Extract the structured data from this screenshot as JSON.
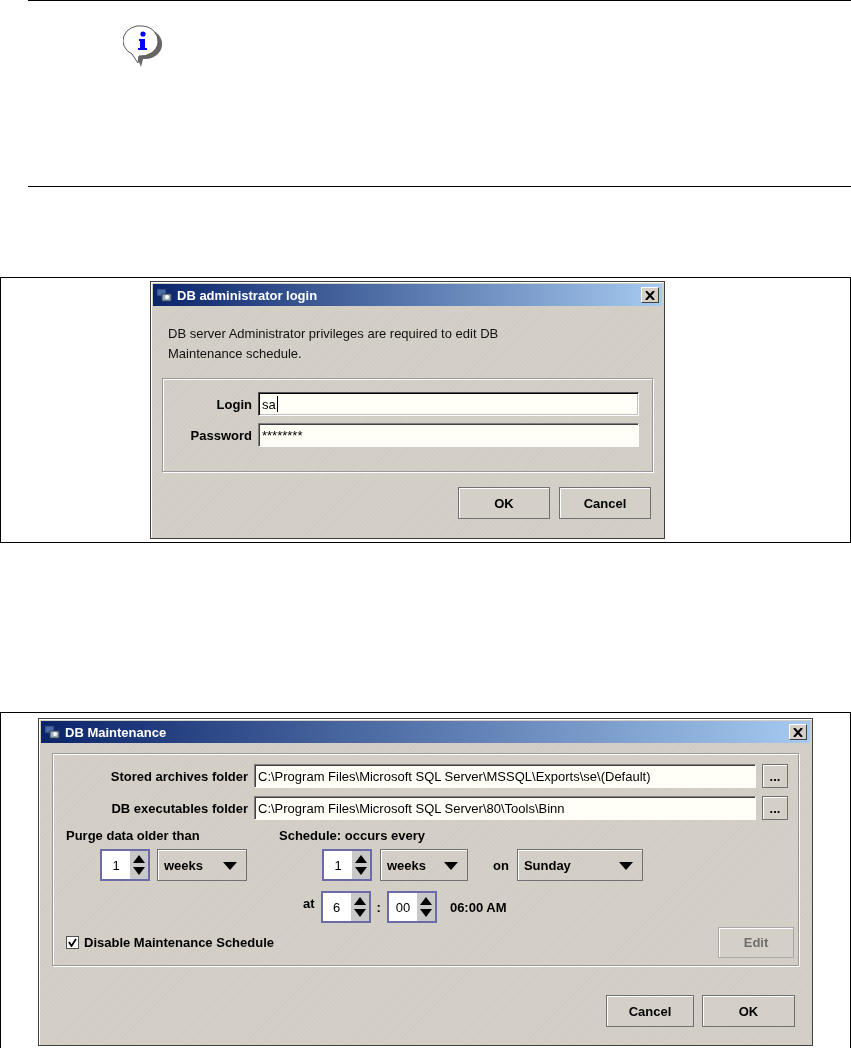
{
  "login_dialog": {
    "title": "DB administrator login",
    "message": "DB server Administrator privileges are required to edit DB Maintenance schedule.",
    "fields": [
      {
        "label": "Login",
        "value": "sa",
        "focused": true
      },
      {
        "label": "Password",
        "value": "********",
        "focused": false
      }
    ],
    "buttons": [
      "OK",
      "Cancel"
    ]
  },
  "maintenance_dialog": {
    "title": "DB Maintenance",
    "folders": [
      {
        "label": "Stored archives folder",
        "value": "C:\\Program Files\\Microsoft SQL Server\\MSSQL\\Exports\\se\\(Default)",
        "browse": "..."
      },
      {
        "label": "DB executables folder",
        "value": "C:\\Program Files\\Microsoft SQL Server\\80\\Tools\\Binn",
        "browse": "..."
      }
    ],
    "purge": {
      "label": "Purge data older than",
      "amount": "1",
      "unit": "weeks"
    },
    "schedule": {
      "label": "Schedule:  occurs every",
      "amount": "1",
      "unit": "weeks",
      "on_label": "on",
      "day": "Sunday",
      "at_label": "at",
      "hour": "6",
      "separator": ":",
      "minute": "00",
      "time": "06:00 AM"
    },
    "disable": {
      "label": "Disable Maintenance Schedule",
      "checked": true
    },
    "edit_button": {
      "label": "Edit",
      "disabled": true
    },
    "buttons": [
      "Cancel",
      "OK"
    ]
  }
}
